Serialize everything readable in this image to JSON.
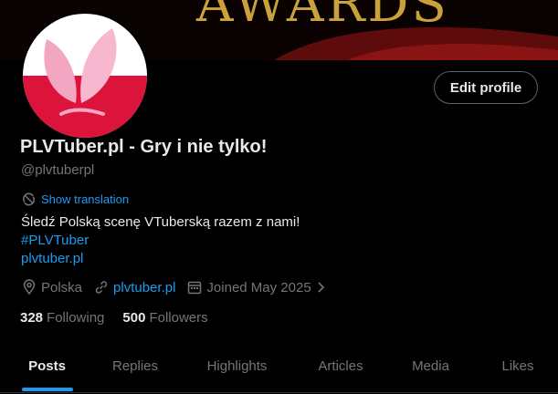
{
  "banner": {
    "text": "AWARDS"
  },
  "profile": {
    "display_name": "PLVTuber.pl - Gry i nie tylko!",
    "handle": "@plvtuberpl",
    "edit_label": "Edit profile",
    "translate_label": "Show translation",
    "translate_icon": "translate-icon",
    "bio": {
      "line1": "Śledź Polską scenę VTuberską razem z nami!",
      "hashtag": "#PLVTuber",
      "link": "plvtuber.pl"
    },
    "meta": {
      "location": "Polska",
      "website": "plvtuber.pl",
      "joined": "Joined May 2025",
      "location_icon": "location-pin-icon",
      "link_icon": "link-icon",
      "calendar_icon": "calendar-icon"
    },
    "following": {
      "value": "328",
      "label": "Following"
    },
    "followers": {
      "value": "500",
      "label": "Followers"
    }
  },
  "tabs": [
    {
      "label": "Posts"
    },
    {
      "label": "Replies"
    },
    {
      "label": "Highlights"
    },
    {
      "label": "Articles"
    },
    {
      "label": "Media"
    },
    {
      "label": "Likes"
    }
  ],
  "colors": {
    "accent": "#1d9bf0",
    "text": "#e7e9ea",
    "muted": "#71767b",
    "border": "#536471",
    "gold": "#c9a23c"
  }
}
